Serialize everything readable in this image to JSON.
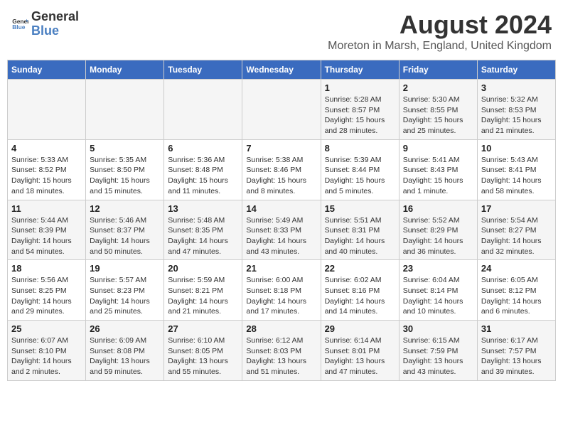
{
  "header": {
    "logo_general": "General",
    "logo_blue": "Blue",
    "main_title": "August 2024",
    "subtitle": "Moreton in Marsh, England, United Kingdom"
  },
  "calendar": {
    "days_of_week": [
      "Sunday",
      "Monday",
      "Tuesday",
      "Wednesday",
      "Thursday",
      "Friday",
      "Saturday"
    ],
    "weeks": [
      [
        {
          "day": "",
          "info": ""
        },
        {
          "day": "",
          "info": ""
        },
        {
          "day": "",
          "info": ""
        },
        {
          "day": "",
          "info": ""
        },
        {
          "day": "1",
          "info": "Sunrise: 5:28 AM\nSunset: 8:57 PM\nDaylight: 15 hours\nand 28 minutes."
        },
        {
          "day": "2",
          "info": "Sunrise: 5:30 AM\nSunset: 8:55 PM\nDaylight: 15 hours\nand 25 minutes."
        },
        {
          "day": "3",
          "info": "Sunrise: 5:32 AM\nSunset: 8:53 PM\nDaylight: 15 hours\nand 21 minutes."
        }
      ],
      [
        {
          "day": "4",
          "info": "Sunrise: 5:33 AM\nSunset: 8:52 PM\nDaylight: 15 hours\nand 18 minutes."
        },
        {
          "day": "5",
          "info": "Sunrise: 5:35 AM\nSunset: 8:50 PM\nDaylight: 15 hours\nand 15 minutes."
        },
        {
          "day": "6",
          "info": "Sunrise: 5:36 AM\nSunset: 8:48 PM\nDaylight: 15 hours\nand 11 minutes."
        },
        {
          "day": "7",
          "info": "Sunrise: 5:38 AM\nSunset: 8:46 PM\nDaylight: 15 hours\nand 8 minutes."
        },
        {
          "day": "8",
          "info": "Sunrise: 5:39 AM\nSunset: 8:44 PM\nDaylight: 15 hours\nand 5 minutes."
        },
        {
          "day": "9",
          "info": "Sunrise: 5:41 AM\nSunset: 8:43 PM\nDaylight: 15 hours\nand 1 minute."
        },
        {
          "day": "10",
          "info": "Sunrise: 5:43 AM\nSunset: 8:41 PM\nDaylight: 14 hours\nand 58 minutes."
        }
      ],
      [
        {
          "day": "11",
          "info": "Sunrise: 5:44 AM\nSunset: 8:39 PM\nDaylight: 14 hours\nand 54 minutes."
        },
        {
          "day": "12",
          "info": "Sunrise: 5:46 AM\nSunset: 8:37 PM\nDaylight: 14 hours\nand 50 minutes."
        },
        {
          "day": "13",
          "info": "Sunrise: 5:48 AM\nSunset: 8:35 PM\nDaylight: 14 hours\nand 47 minutes."
        },
        {
          "day": "14",
          "info": "Sunrise: 5:49 AM\nSunset: 8:33 PM\nDaylight: 14 hours\nand 43 minutes."
        },
        {
          "day": "15",
          "info": "Sunrise: 5:51 AM\nSunset: 8:31 PM\nDaylight: 14 hours\nand 40 minutes."
        },
        {
          "day": "16",
          "info": "Sunrise: 5:52 AM\nSunset: 8:29 PM\nDaylight: 14 hours\nand 36 minutes."
        },
        {
          "day": "17",
          "info": "Sunrise: 5:54 AM\nSunset: 8:27 PM\nDaylight: 14 hours\nand 32 minutes."
        }
      ],
      [
        {
          "day": "18",
          "info": "Sunrise: 5:56 AM\nSunset: 8:25 PM\nDaylight: 14 hours\nand 29 minutes."
        },
        {
          "day": "19",
          "info": "Sunrise: 5:57 AM\nSunset: 8:23 PM\nDaylight: 14 hours\nand 25 minutes."
        },
        {
          "day": "20",
          "info": "Sunrise: 5:59 AM\nSunset: 8:21 PM\nDaylight: 14 hours\nand 21 minutes."
        },
        {
          "day": "21",
          "info": "Sunrise: 6:00 AM\nSunset: 8:18 PM\nDaylight: 14 hours\nand 17 minutes."
        },
        {
          "day": "22",
          "info": "Sunrise: 6:02 AM\nSunset: 8:16 PM\nDaylight: 14 hours\nand 14 minutes."
        },
        {
          "day": "23",
          "info": "Sunrise: 6:04 AM\nSunset: 8:14 PM\nDaylight: 14 hours\nand 10 minutes."
        },
        {
          "day": "24",
          "info": "Sunrise: 6:05 AM\nSunset: 8:12 PM\nDaylight: 14 hours\nand 6 minutes."
        }
      ],
      [
        {
          "day": "25",
          "info": "Sunrise: 6:07 AM\nSunset: 8:10 PM\nDaylight: 14 hours\nand 2 minutes."
        },
        {
          "day": "26",
          "info": "Sunrise: 6:09 AM\nSunset: 8:08 PM\nDaylight: 13 hours\nand 59 minutes."
        },
        {
          "day": "27",
          "info": "Sunrise: 6:10 AM\nSunset: 8:05 PM\nDaylight: 13 hours\nand 55 minutes."
        },
        {
          "day": "28",
          "info": "Sunrise: 6:12 AM\nSunset: 8:03 PM\nDaylight: 13 hours\nand 51 minutes."
        },
        {
          "day": "29",
          "info": "Sunrise: 6:14 AM\nSunset: 8:01 PM\nDaylight: 13 hours\nand 47 minutes."
        },
        {
          "day": "30",
          "info": "Sunrise: 6:15 AM\nSunset: 7:59 PM\nDaylight: 13 hours\nand 43 minutes."
        },
        {
          "day": "31",
          "info": "Sunrise: 6:17 AM\nSunset: 7:57 PM\nDaylight: 13 hours\nand 39 minutes."
        }
      ]
    ]
  }
}
